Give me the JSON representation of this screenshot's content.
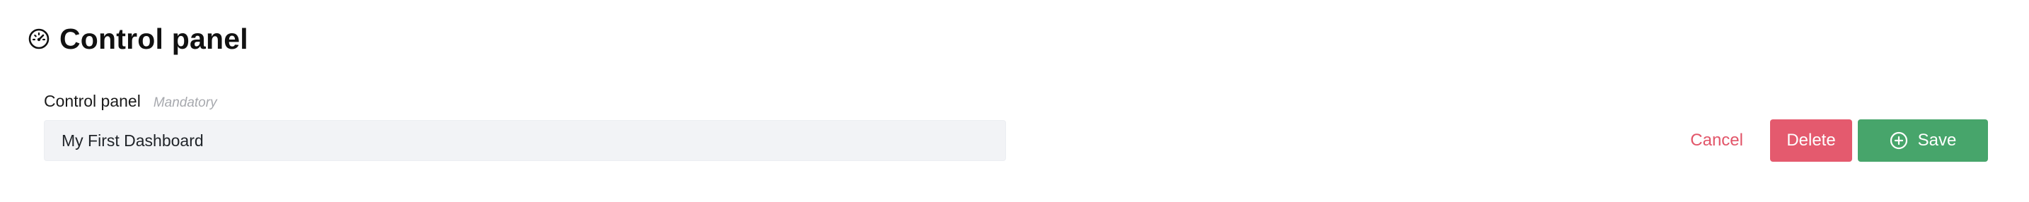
{
  "header": {
    "title": "Control panel",
    "icon": "speedometer-icon"
  },
  "form": {
    "field_label": "Control panel",
    "field_hint": "Mandatory",
    "field_value": "My First Dashboard"
  },
  "actions": {
    "cancel_label": "Cancel",
    "delete_label": "Delete",
    "save_label": "Save",
    "save_icon": "plus-circle-icon"
  },
  "colors": {
    "danger": "#e45a6e",
    "success": "#47a56b",
    "input_background": "#f2f3f6"
  }
}
